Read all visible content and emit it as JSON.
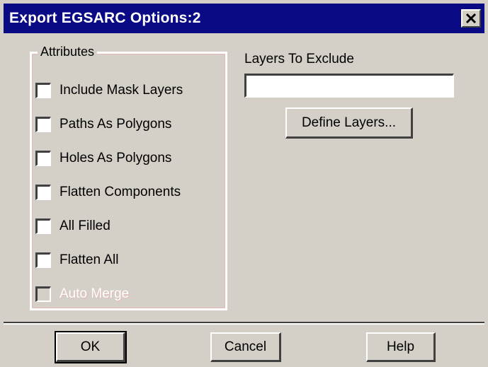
{
  "window": {
    "title": "Export EGSARC Options:2",
    "close_glyph": "close-icon"
  },
  "attributes": {
    "group_label": "Attributes",
    "options": [
      {
        "label": "Include Mask Layers",
        "checked": false,
        "enabled": true
      },
      {
        "label": "Paths As Polygons",
        "checked": false,
        "enabled": true
      },
      {
        "label": "Holes As Polygons",
        "checked": false,
        "enabled": true
      },
      {
        "label": "Flatten Components",
        "checked": false,
        "enabled": true
      },
      {
        "label": "All Filled",
        "checked": false,
        "enabled": true
      },
      {
        "label": "Flatten All",
        "checked": false,
        "enabled": true
      },
      {
        "label": "Auto Merge",
        "checked": false,
        "enabled": false
      }
    ]
  },
  "exclude": {
    "label": "Layers To Exclude",
    "value": "",
    "define_button": "Define Layers..."
  },
  "buttons": {
    "ok": "OK",
    "cancel": "Cancel",
    "help": "Help"
  },
  "colors": {
    "title_bar": "#0a0a84",
    "face": "#d4d0c8"
  }
}
